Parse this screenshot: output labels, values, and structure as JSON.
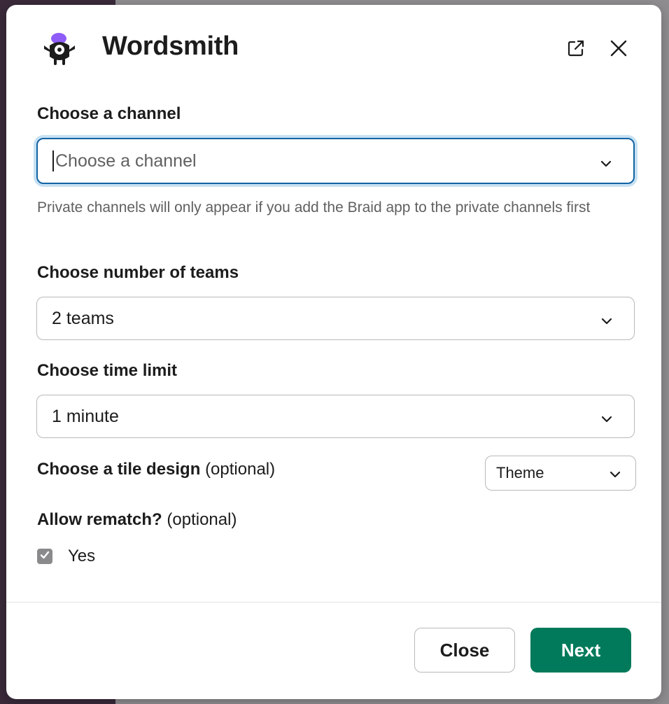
{
  "app": {
    "title": "Wordsmith",
    "icon": "wordsmith-monster-icon"
  },
  "header": {
    "open_icon": "open-external-icon",
    "close_icon": "close-icon"
  },
  "channel": {
    "label": "Choose a channel",
    "placeholder": "Choose a channel",
    "hint": "Private channels will only appear if you add the Braid app to the private channels first"
  },
  "teams": {
    "label": "Choose number of teams",
    "value": "2 teams"
  },
  "time_limit": {
    "label": "Choose time limit",
    "value": "1 minute"
  },
  "tile_design": {
    "label": "Choose a tile design",
    "optional": "(optional)",
    "value": "Theme"
  },
  "rematch": {
    "label": "Allow rematch?",
    "optional": "(optional)",
    "option_label": "Yes",
    "checked": true
  },
  "footer": {
    "close_label": "Close",
    "next_label": "Next"
  },
  "colors": {
    "primary": "#007a5a",
    "focus_ring": "#1264a3",
    "icon_purple": "#8f5cf7"
  }
}
